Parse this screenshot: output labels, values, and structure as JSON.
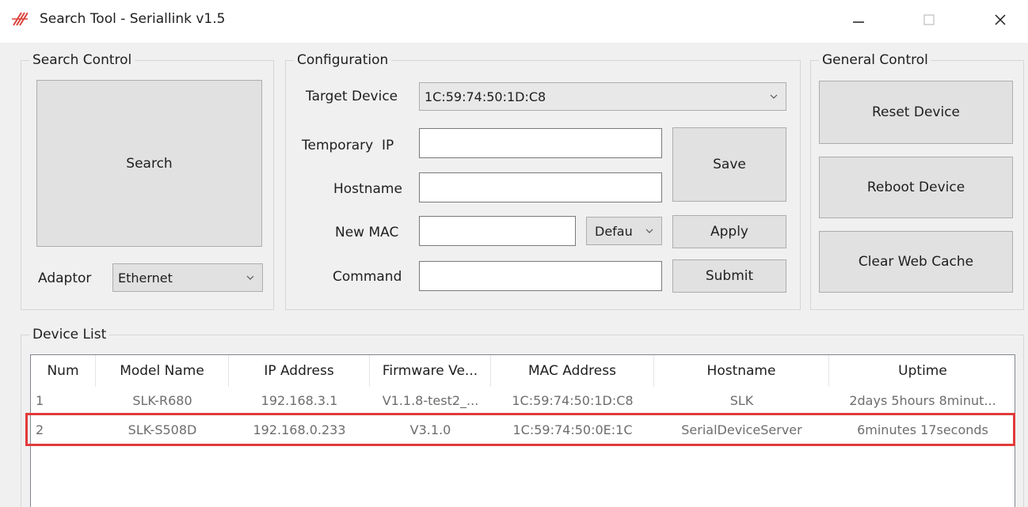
{
  "window": {
    "title": "Search Tool - Seriallink v1.5",
    "app_icon": "seriallink-logo-icon"
  },
  "search_control": {
    "legend": "Search Control",
    "search_label": "Search",
    "adaptor_label": "Adaptor",
    "adaptor_value": "Ethernet"
  },
  "configuration": {
    "legend": "Configuration",
    "target_device_label": "Target Device",
    "target_device_value": "1C:59:74:50:1D:C8",
    "temporary_ip_label": "Temporary  IP",
    "temporary_ip_value": "",
    "hostname_label": "Hostname",
    "hostname_value": "",
    "new_mac_label": "New MAC",
    "new_mac_value": "",
    "mac_mode_value": "Defau",
    "command_label": "Command",
    "command_value": "",
    "save_label": "Save",
    "apply_label": "Apply",
    "submit_label": "Submit"
  },
  "general_control": {
    "legend": "General Control",
    "reset_label": "Reset Device",
    "reboot_label": "Reboot Device",
    "clear_cache_label": "Clear Web Cache"
  },
  "device_list": {
    "legend": "Device List",
    "columns": [
      "Num",
      "Model Name",
      "IP Address",
      "Firmware Ve...",
      "MAC Address",
      "Hostname",
      "Uptime"
    ],
    "rows": [
      [
        "1",
        "SLK-R680",
        "192.168.3.1",
        "V1.1.8-test2_...",
        "1C:59:74:50:1D:C8",
        "SLK",
        "2days 5hours 8minut..."
      ],
      [
        "2",
        "SLK-S508D",
        "192.168.0.233",
        "V3.1.0",
        "1C:59:74:50:0E:1C",
        "SerialDeviceServer",
        "6minutes 17seconds"
      ]
    ],
    "highlight_color": "#e23a3a"
  }
}
